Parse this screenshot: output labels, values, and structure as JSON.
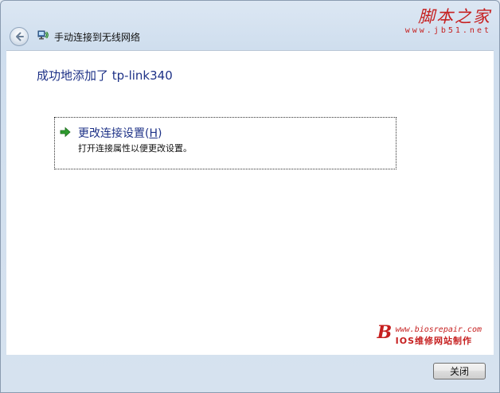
{
  "header": {
    "title": "手动连接到无线网络",
    "back_icon": "back-arrow-icon",
    "network_icon": "wireless-network-icon"
  },
  "watermark_top": {
    "title": "脚本之家",
    "url": "www.jb51.net"
  },
  "main": {
    "heading": "成功地添加了 tp-link340",
    "task": {
      "icon": "green-arrow-icon",
      "title_prefix": "更改连接设置(",
      "title_access_key": "H",
      "title_suffix": ")",
      "description": "打开连接属性以便更改设置。"
    }
  },
  "watermark_bottom": {
    "letter": "B",
    "url": "www.biosrepair.com",
    "text_prefix": "IOS",
    "text": "维修网站制作"
  },
  "footer": {
    "close_label": "关闭"
  },
  "colors": {
    "link": "#1e3287",
    "watermark": "#c61f1f"
  }
}
